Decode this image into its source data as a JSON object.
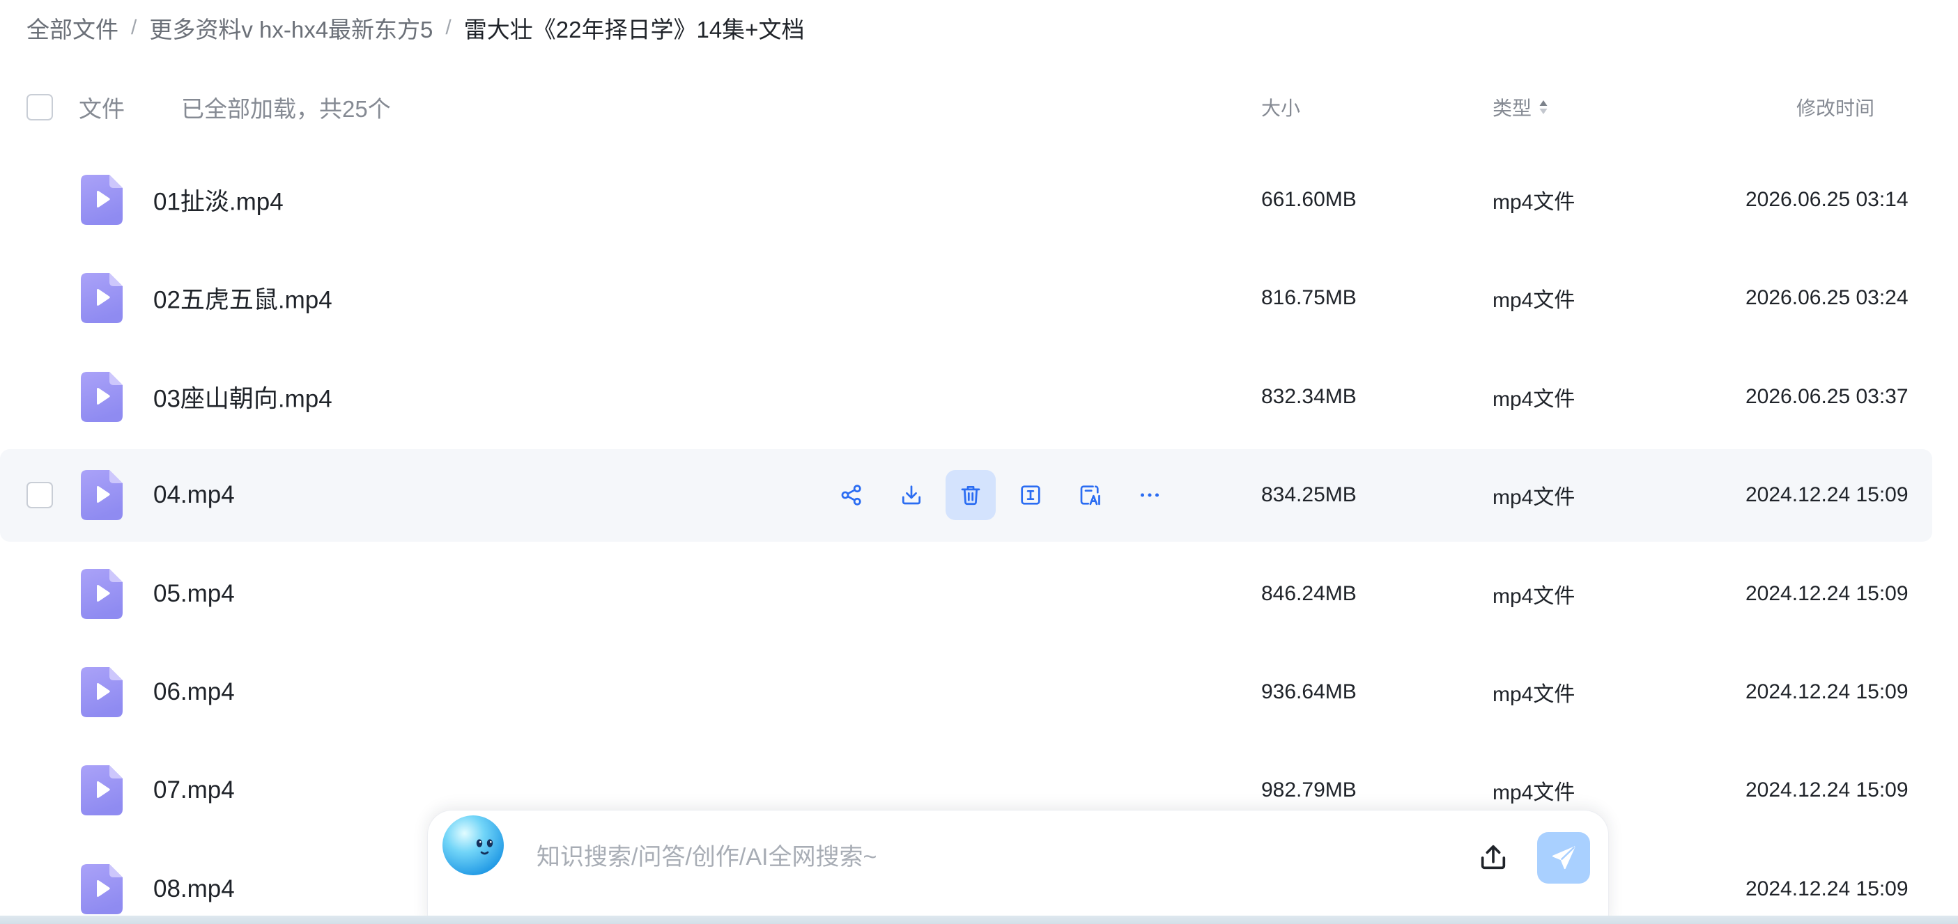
{
  "breadcrumb": {
    "separator": "/",
    "items": [
      {
        "label": "全部文件"
      },
      {
        "label": "更多资料v hx-hx4最新东方5"
      },
      {
        "label": "雷大壮《22年择日学》14集+文档",
        "current": true
      }
    ]
  },
  "list_header": {
    "select_all_checked": false,
    "file_label": "文件",
    "load_status": "已全部加载，共25个",
    "size_label": "大小",
    "type_label": "类型",
    "type_sort_icon": "sort-icon",
    "mtime_label": "修改时间"
  },
  "file_icon": "video-file-icon",
  "files": [
    {
      "name": "01扯淡.mp4",
      "size": "661.60MB",
      "type": "mp4文件",
      "mtime": "2026.06.25 03:14"
    },
    {
      "name": "02五虎五鼠.mp4",
      "size": "816.75MB",
      "type": "mp4文件",
      "mtime": "2026.06.25 03:24"
    },
    {
      "name": "03座山朝向.mp4",
      "size": "832.34MB",
      "type": "mp4文件",
      "mtime": "2026.06.25 03:37"
    },
    {
      "name": "04.mp4",
      "size": "834.25MB",
      "type": "mp4文件",
      "mtime": "2024.12.24 15:09"
    },
    {
      "name": "05.mp4",
      "size": "846.24MB",
      "type": "mp4文件",
      "mtime": "2024.12.24 15:09"
    },
    {
      "name": "06.mp4",
      "size": "936.64MB",
      "type": "mp4文件",
      "mtime": "2024.12.24 15:09"
    },
    {
      "name": "07.mp4",
      "size": "982.79MB",
      "type": "mp4文件",
      "mtime": "2024.12.24 15:09"
    },
    {
      "name": "08.mp4",
      "mtime": "2024.12.24 15:09"
    }
  ],
  "hovered_row": {
    "index": 3,
    "checkbox_checked": false,
    "actions": [
      {
        "icon": "share-icon"
      },
      {
        "icon": "download-icon"
      },
      {
        "icon": "trash-icon",
        "highlighted": true
      },
      {
        "icon": "rename-icon"
      },
      {
        "icon": "ai-document-icon"
      },
      {
        "icon": "more-icon"
      }
    ]
  },
  "assistant_bar": {
    "avatar": "assistant-avatar-icon",
    "placeholder": "知识搜索/问答/创作/AI全网搜索~",
    "upload_icon": "upload-icon",
    "send_icon": "send-icon"
  },
  "colors": {
    "accent": "#2a6cf2",
    "text_primary": "#1f2329",
    "text_secondary": "#6b7078",
    "text_muted": "#858a93",
    "separator": "#a2a7ae",
    "row_hover_bg": "#f5f7fa",
    "action_hover_bg": "#d4e3fd",
    "checkbox_border": "#c9ced6",
    "placeholder": "#a8adb5",
    "send_button_bg": "#a9d0ff",
    "file_icon_light": "#aaa2f8",
    "file_icon_dark": "#8f8bf1",
    "bottom_strip": "#d3dfe8"
  }
}
